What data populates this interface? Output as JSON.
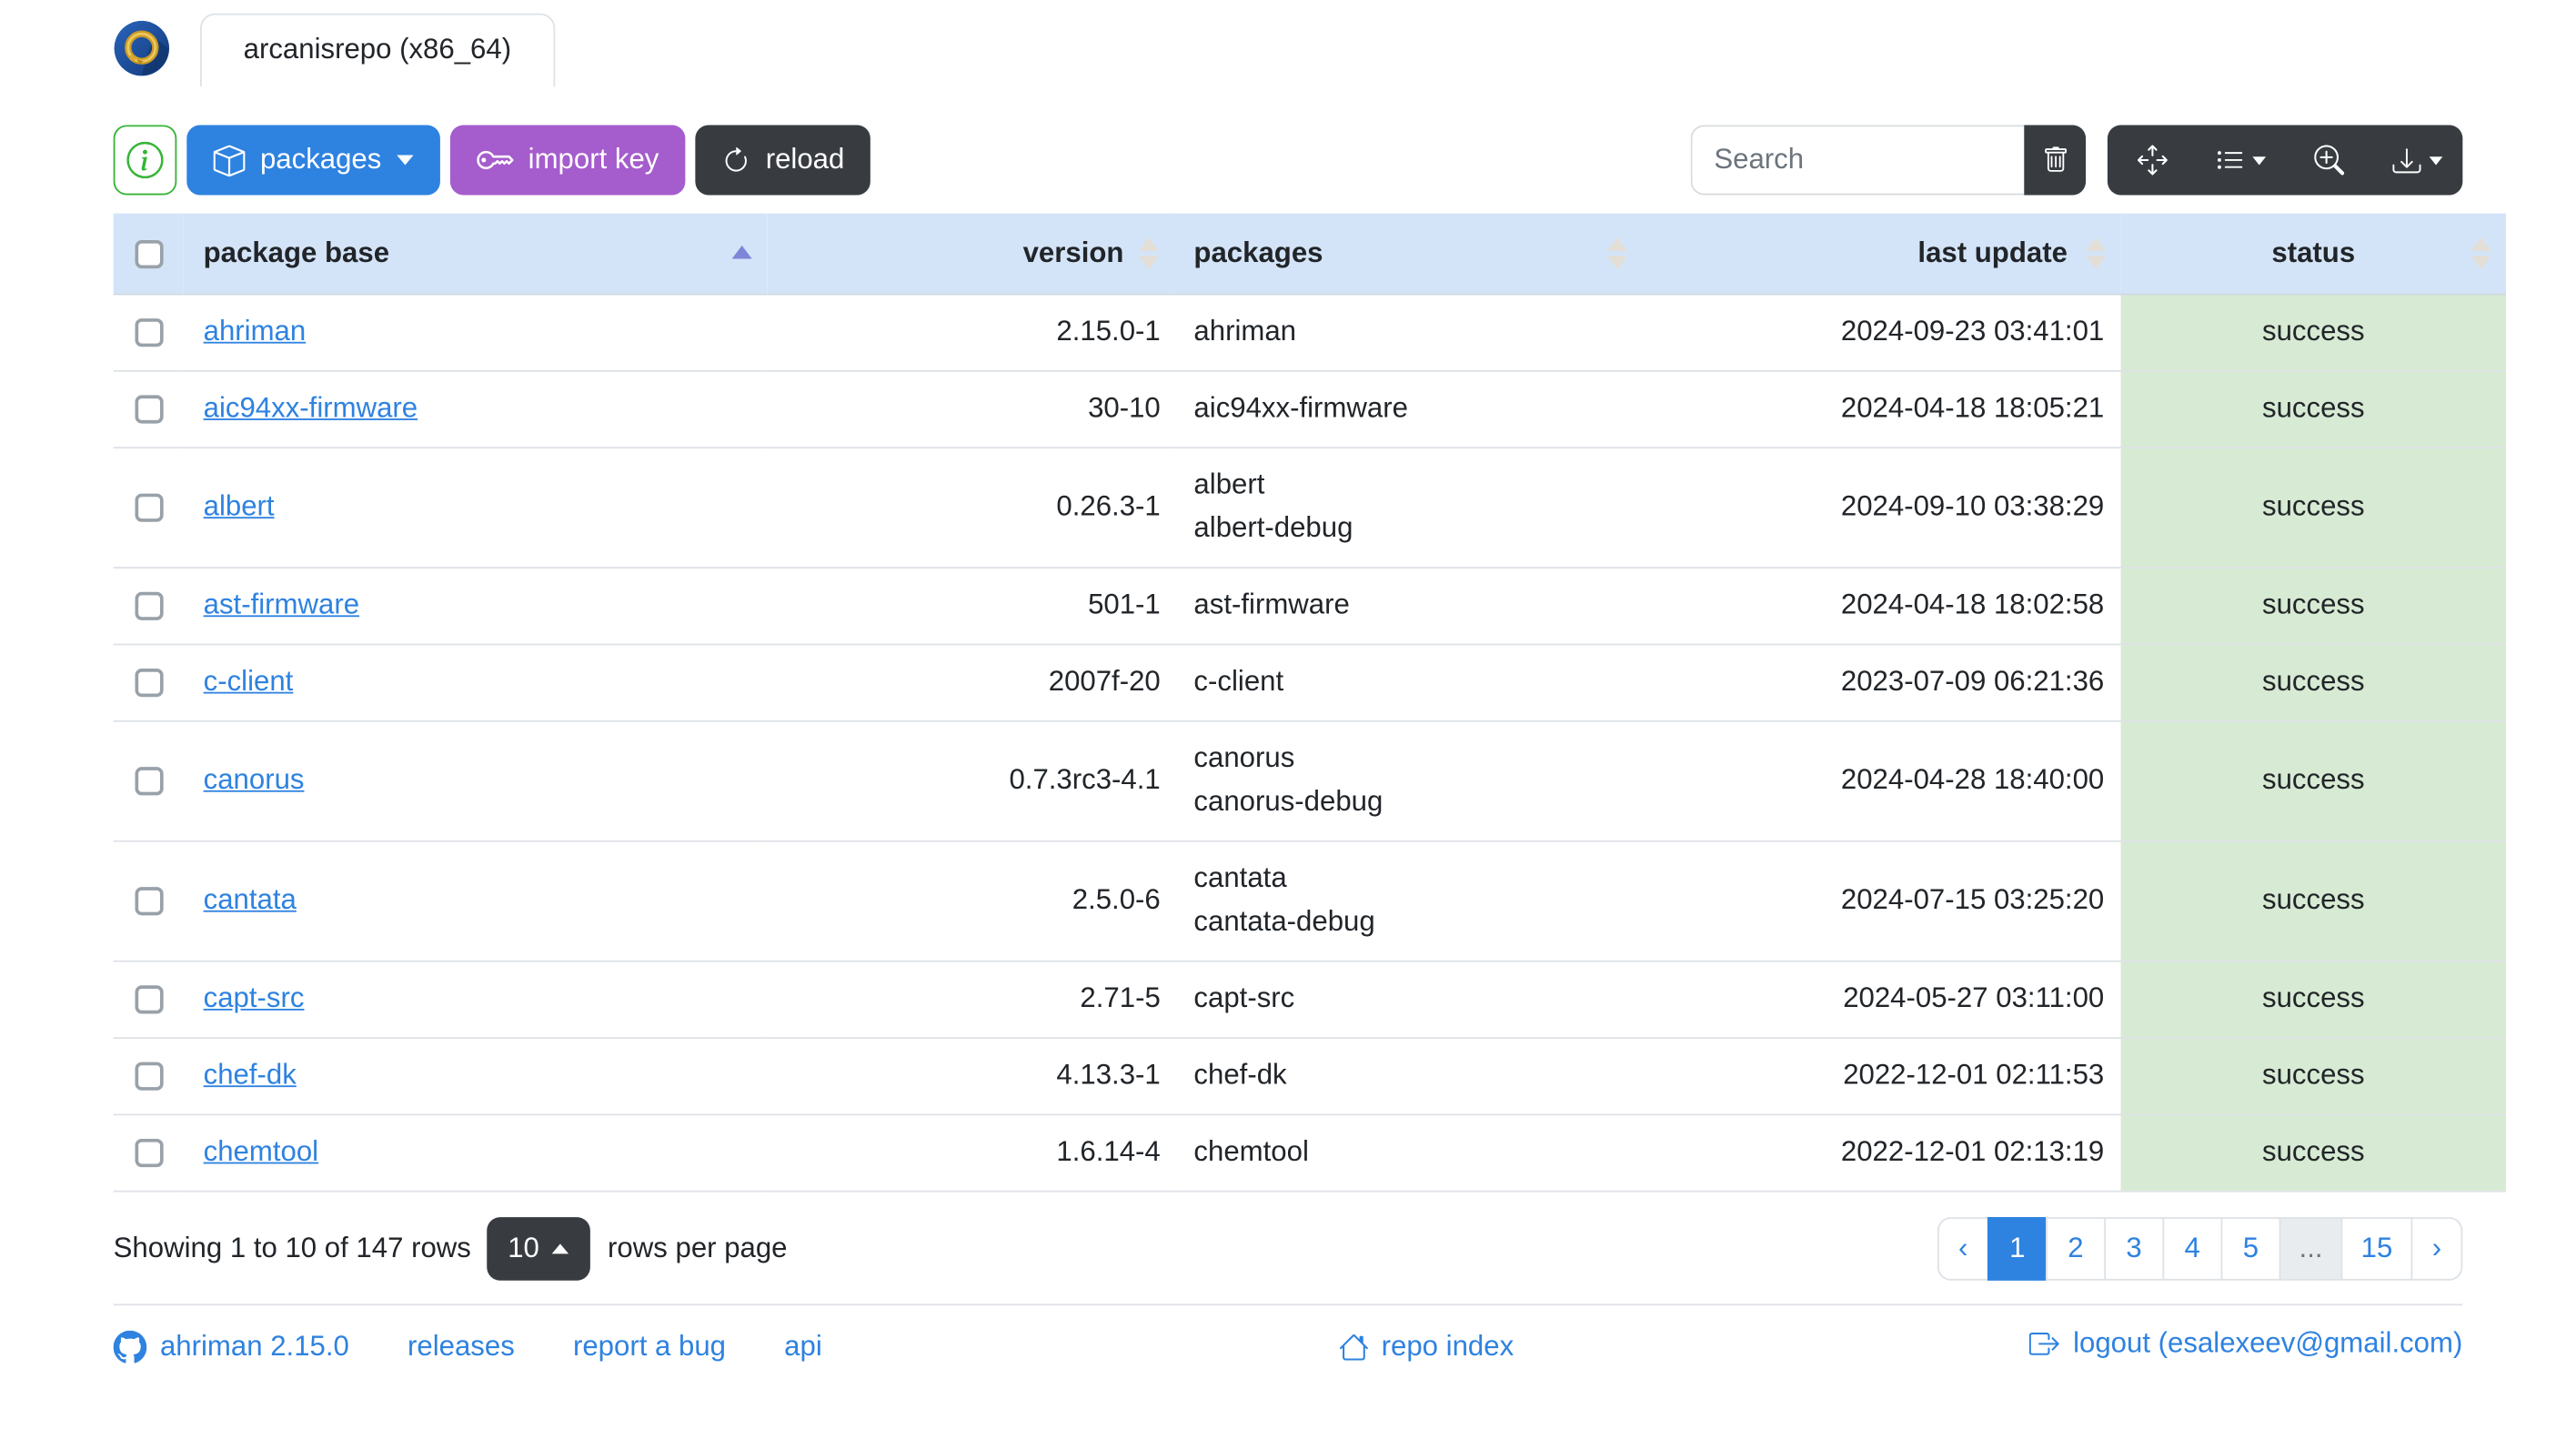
{
  "window": {
    "tab_title": "arcanisrepo (x86_64)"
  },
  "toolbar": {
    "info_button": {
      "icon": "info-circle-icon"
    },
    "packages_button": {
      "label": "packages",
      "icon": "box-icon"
    },
    "import_key_button": {
      "label": "import key",
      "icon": "key-icon"
    },
    "reload_button": {
      "label": "reload",
      "icon": "arrow-clockwise-icon"
    },
    "search": {
      "placeholder": "Search"
    },
    "clear_button": {
      "icon": "trash-icon"
    },
    "view_group": {
      "fullscreen": "arrows-move-icon",
      "columns": "list-columns-icon",
      "zoom": "zoom-in-icon",
      "export": "download-icon"
    }
  },
  "table": {
    "columns": [
      {
        "key": "select",
        "label": ""
      },
      {
        "key": "base",
        "label": "package base",
        "sorted": "asc"
      },
      {
        "key": "version",
        "label": "version"
      },
      {
        "key": "packages",
        "label": "packages"
      },
      {
        "key": "last_update",
        "label": "last update"
      },
      {
        "key": "status",
        "label": "status"
      }
    ],
    "rows": [
      {
        "base": "ahriman",
        "version": "2.15.0-1",
        "packages": [
          "ahriman"
        ],
        "last_update": "2024-09-23 03:41:01",
        "status": "success"
      },
      {
        "base": "aic94xx-firmware",
        "version": "30-10",
        "packages": [
          "aic94xx-firmware"
        ],
        "last_update": "2024-04-18 18:05:21",
        "status": "success"
      },
      {
        "base": "albert",
        "version": "0.26.3-1",
        "packages": [
          "albert",
          "albert-debug"
        ],
        "last_update": "2024-09-10 03:38:29",
        "status": "success"
      },
      {
        "base": "ast-firmware",
        "version": "501-1",
        "packages": [
          "ast-firmware"
        ],
        "last_update": "2024-04-18 18:02:58",
        "status": "success"
      },
      {
        "base": "c-client",
        "version": "2007f-20",
        "packages": [
          "c-client"
        ],
        "last_update": "2023-07-09 06:21:36",
        "status": "success"
      },
      {
        "base": "canorus",
        "version": "0.7.3rc3-4.1",
        "packages": [
          "canorus",
          "canorus-debug"
        ],
        "last_update": "2024-04-28 18:40:00",
        "status": "success"
      },
      {
        "base": "cantata",
        "version": "2.5.0-6",
        "packages": [
          "cantata",
          "cantata-debug"
        ],
        "last_update": "2024-07-15 03:25:20",
        "status": "success"
      },
      {
        "base": "capt-src",
        "version": "2.71-5",
        "packages": [
          "capt-src"
        ],
        "last_update": "2024-05-27 03:11:00",
        "status": "success"
      },
      {
        "base": "chef-dk",
        "version": "4.13.3-1",
        "packages": [
          "chef-dk"
        ],
        "last_update": "2022-12-01 02:11:53",
        "status": "success"
      },
      {
        "base": "chemtool",
        "version": "1.6.14-4",
        "packages": [
          "chemtool"
        ],
        "last_update": "2022-12-01 02:13:19",
        "status": "success"
      }
    ]
  },
  "pagination": {
    "summary": "Showing 1 to 10 of 147 rows",
    "page_size": "10",
    "rows_per_page_label": "rows per page",
    "items": [
      {
        "label": "‹",
        "name": "prev-page-button"
      },
      {
        "label": "1",
        "state": "active",
        "name": "page-button-1"
      },
      {
        "label": "2",
        "name": "page-button-2"
      },
      {
        "label": "3",
        "name": "page-button-3"
      },
      {
        "label": "4",
        "name": "page-button-4"
      },
      {
        "label": "5",
        "name": "page-button-5"
      },
      {
        "label": "...",
        "state": "disabled",
        "name": "page-ellipsis"
      },
      {
        "label": "15",
        "name": "page-button-15"
      },
      {
        "label": "›",
        "name": "next-page-button"
      }
    ]
  },
  "footer": {
    "version_link": "ahriman 2.15.0",
    "releases_link": "releases",
    "report_bug_link": "report a bug",
    "api_link": "api",
    "repo_index_link": "repo index",
    "logout_link": "logout (esalexeev@gmail.com)"
  },
  "colors": {
    "primary_blue": "#2e82e0",
    "purple": "#a55ccd",
    "dark": "#383c41",
    "info_green": "#37b437",
    "header_bg": "#d4e4f8",
    "status_success_bg": "#d7ead3",
    "link_blue": "#2e82e0",
    "sort_active": "#7d86d9",
    "sort_inactive": "#e3ded6",
    "border": "#dee2e6"
  }
}
